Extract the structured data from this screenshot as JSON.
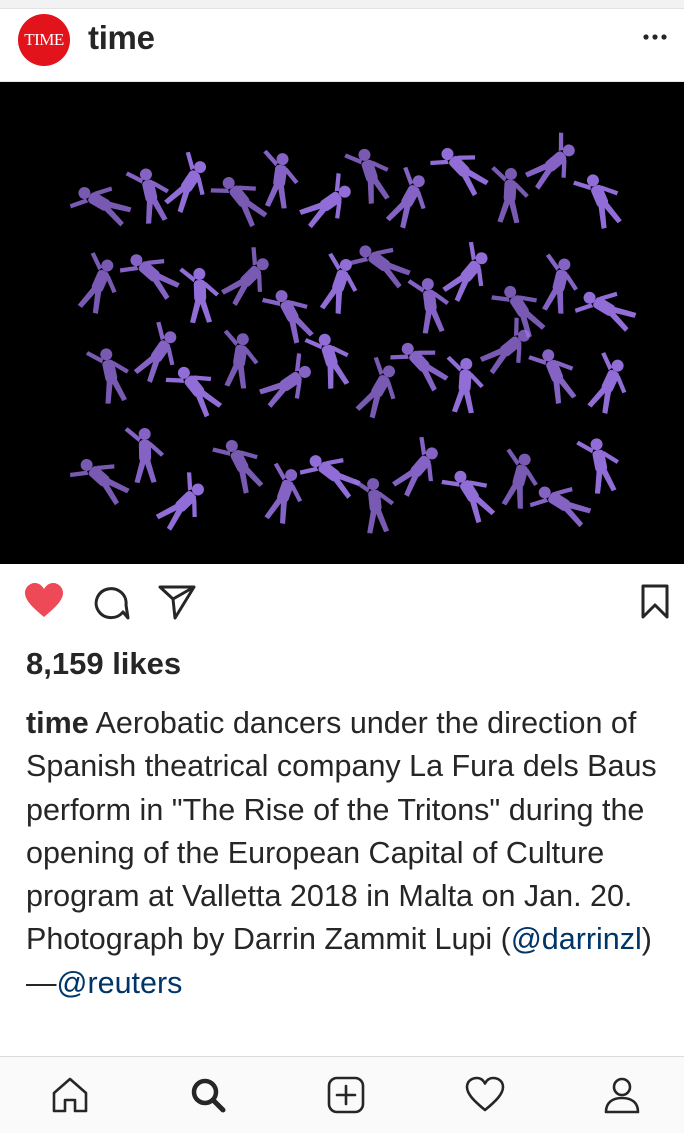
{
  "post": {
    "avatar_text": "TIME",
    "username": "time",
    "more_icon": "more-dots-icon",
    "photo_description_icon": "aerial-dancers-photo",
    "likes_text": "8,159 likes",
    "caption": {
      "username": "time",
      "text_before_mention": " Aerobatic dancers under the direction of Spanish theatrical company La Fura dels Baus perform in \"The Rise of the Tritons\" during the opening of the European Capital of Culture program at Valletta 2018 in Malta on Jan. 20. Photograph by Darrin Zammit Lupi (",
      "mention_photographer": "@darrinzl",
      "text_between": ")—",
      "mention_agency": "@reuters"
    }
  },
  "actions": {
    "like_icon": "heart-filled-icon",
    "comment_icon": "comment-icon",
    "share_icon": "paper-plane-icon",
    "save_icon": "bookmark-icon"
  },
  "tabbar": {
    "items": [
      "home-icon",
      "search-icon",
      "add-post-icon",
      "activity-heart-icon",
      "profile-icon"
    ]
  },
  "colors": {
    "brand_red": "#e3131b",
    "like_red": "#ed4956",
    "link_blue": "#003569",
    "dancer_purple": "#9b74e6"
  }
}
